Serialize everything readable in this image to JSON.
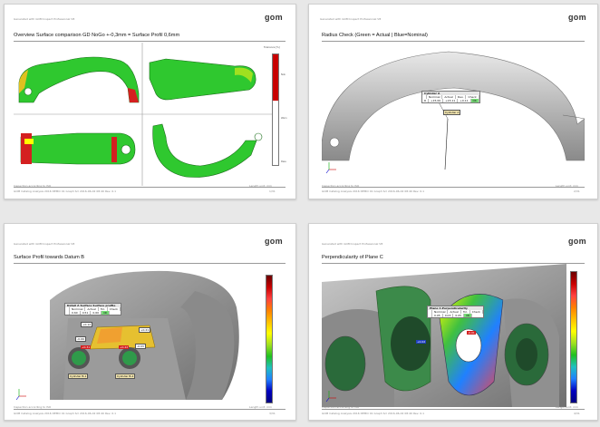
{
  "logo_text": "gom",
  "header_small": "Generated with GOM Inspect Professional V8",
  "footer_text": "Inspection according to ISO",
  "footer_sub": "GOM    Catalog   Analysis   2016   DEMO   01   Graph   Scl   2016-06-02   08:40   Rev.   0.1",
  "footer_right": "Length unit: mm",
  "pages": [
    {
      "title": "Overview Surface comparison GD NoGo +-0,3mm = Surface Profil 0,6mm",
      "legend_title": "Tolerance [%]",
      "legend_labels": [
        "Nok",
        "Warn",
        "Pass"
      ],
      "page_no": "1/31"
    },
    {
      "title": "Radius Check (Green = Actual | Blue=Nominal)",
      "table_title": "Cylinder A",
      "table_head": [
        "",
        "Nominal",
        "Actual",
        "Dev.",
        "Check"
      ],
      "table_row": [
        "R",
        "+15.00",
        "+15.11",
        "+0.11",
        "OK"
      ],
      "label": "Cylinder A",
      "page_no": "2/31"
    },
    {
      "title": "Surface Profil towards Datum B",
      "table_title": "Detail A Surface Surface profile",
      "table_head": [
        "",
        "Nominal",
        "Actual",
        "Tol.",
        "Check"
      ],
      "table_row": [
        "",
        "0.60",
        "0.51",
        "0.60",
        "OK"
      ],
      "tags": [
        "+0.12",
        "-0.09",
        "+0.21",
        "+0.31",
        "-0.03",
        "+0.22"
      ],
      "labels": [
        "Cylinder B-1",
        "Cylinder B-2"
      ],
      "page_no": "3/31"
    },
    {
      "title": "Perpendicularity of Plane C",
      "table_title": "Plane C.Perpendicularity",
      "table_head": [
        "",
        "Nominal",
        "Actual",
        "Tol.",
        "Check"
      ],
      "table_row": [
        "",
        "0.05",
        "0.03",
        "0.05",
        "OK"
      ],
      "tags": [
        "+0.02",
        "-0.01"
      ],
      "page_no": "4/31"
    }
  ],
  "colors": {
    "green": "#2fc82f",
    "red": "#d42020",
    "gray_part": "#9a9a9a",
    "legend": [
      "#6b0000",
      "#c80000",
      "#ff2020",
      "#ff8000",
      "#ffc000",
      "#ffff00",
      "#a0e020",
      "#20c020",
      "#20c0c0",
      "#2080ff",
      "#0000c0",
      "#000080"
    ]
  }
}
